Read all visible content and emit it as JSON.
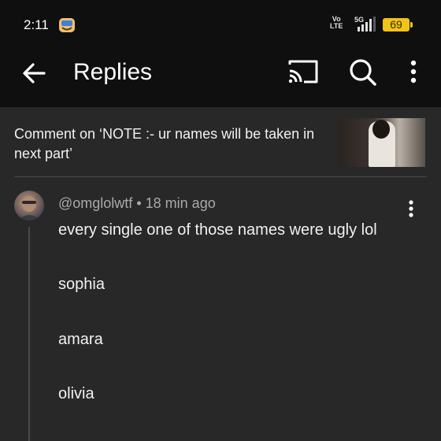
{
  "status_bar": {
    "time": "2:11",
    "network_top": "Vo",
    "network_bottom": "LTE",
    "signal_label": "5G",
    "battery": "69"
  },
  "app_bar": {
    "title": "Replies",
    "icons": [
      "back-arrow-icon",
      "cast-icon",
      "search-icon",
      "more-vert-icon"
    ]
  },
  "context": {
    "text": "Comment on ‘NOTE :- ur names will be taken in next part’"
  },
  "comment": {
    "author": "@omglolwtf",
    "separator": "•",
    "time": "18 min ago",
    "lines": [
      "every single one of those names were ugly lol",
      "sophia",
      "amara",
      "olivia"
    ]
  },
  "colors": {
    "background": "#282828",
    "bar": "#0f0f0f",
    "battery": "#f0c419",
    "meta_text": "#aaaaaa"
  }
}
